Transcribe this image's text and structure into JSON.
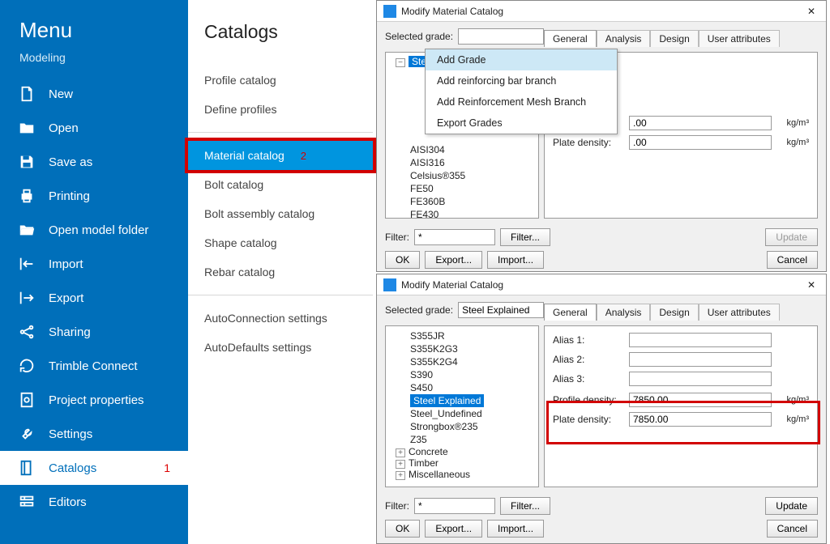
{
  "sidebar": {
    "title": "Menu",
    "subtitle": "Modeling",
    "items": [
      {
        "label": "New"
      },
      {
        "label": "Open"
      },
      {
        "label": "Save as"
      },
      {
        "label": "Printing"
      },
      {
        "label": "Open model folder"
      },
      {
        "label": "Import"
      },
      {
        "label": "Export"
      },
      {
        "label": "Sharing"
      },
      {
        "label": "Trimble Connect"
      },
      {
        "label": "Project properties"
      },
      {
        "label": "Settings"
      },
      {
        "label": "Catalogs",
        "num": "1",
        "selected": true
      },
      {
        "label": "Editors"
      }
    ]
  },
  "catalogs": {
    "title": "Catalogs",
    "groups": [
      [
        "Profile catalog",
        "Define profiles"
      ],
      [
        "Material catalog",
        "Bolt catalog",
        "Bolt assembly catalog",
        "Shape catalog",
        "Rebar catalog"
      ],
      [
        "AutoConnection settings",
        "AutoDefaults settings"
      ]
    ],
    "highlight_index": {
      "group": 1,
      "item": 0
    },
    "highlight_num": "2"
  },
  "context_menu": {
    "items": [
      "Add Grade",
      "Add reinforcing bar branch",
      "Add Reinforcement Mesh Branch",
      "Export Grades"
    ],
    "highlight": 0
  },
  "dialog_labels": {
    "title": "Modify Material Catalog",
    "selected_grade": "Selected grade:",
    "tabs": [
      "General",
      "Analysis",
      "Design",
      "User attributes"
    ],
    "filter": "Filter:",
    "filter_btn": "Filter...",
    "ok": "OK",
    "export": "Export...",
    "import": "Import...",
    "update": "Update",
    "cancel": "Cancel",
    "alias1": "Alias 1:",
    "alias2": "Alias 2:",
    "alias3": "Alias 3:",
    "profile_density": "Profile density:",
    "plate_density": "Plate density:",
    "unit": "kg/m³"
  },
  "dialog1": {
    "grade_value": "",
    "filter_value": "*",
    "tree_root": "Steel",
    "tree_items": [
      "AISI304",
      "AISI316",
      "Celsius®355",
      "FE50",
      "FE360B",
      "FE430"
    ],
    "partial_density_value": ".00",
    "plate_density_label_partial": "Plate density:",
    "plate_density_value_partial": ".00"
  },
  "dialog2": {
    "grade_value": "Steel Explained",
    "filter_value": "*",
    "tree_items_top": [
      "S355JR",
      "S355K2G3",
      "S355K2G4",
      "S390",
      "S450"
    ],
    "tree_selected": "Steel Explained",
    "tree_items_bottom": [
      "Steel_Undefined",
      "Strongbox®235",
      "Z35"
    ],
    "tree_branches": [
      "Concrete",
      "Timber",
      "Miscellaneous"
    ],
    "alias1": "",
    "alias2": "",
    "alias3": "",
    "profile_density": "7850.00",
    "plate_density": "7850.00"
  }
}
